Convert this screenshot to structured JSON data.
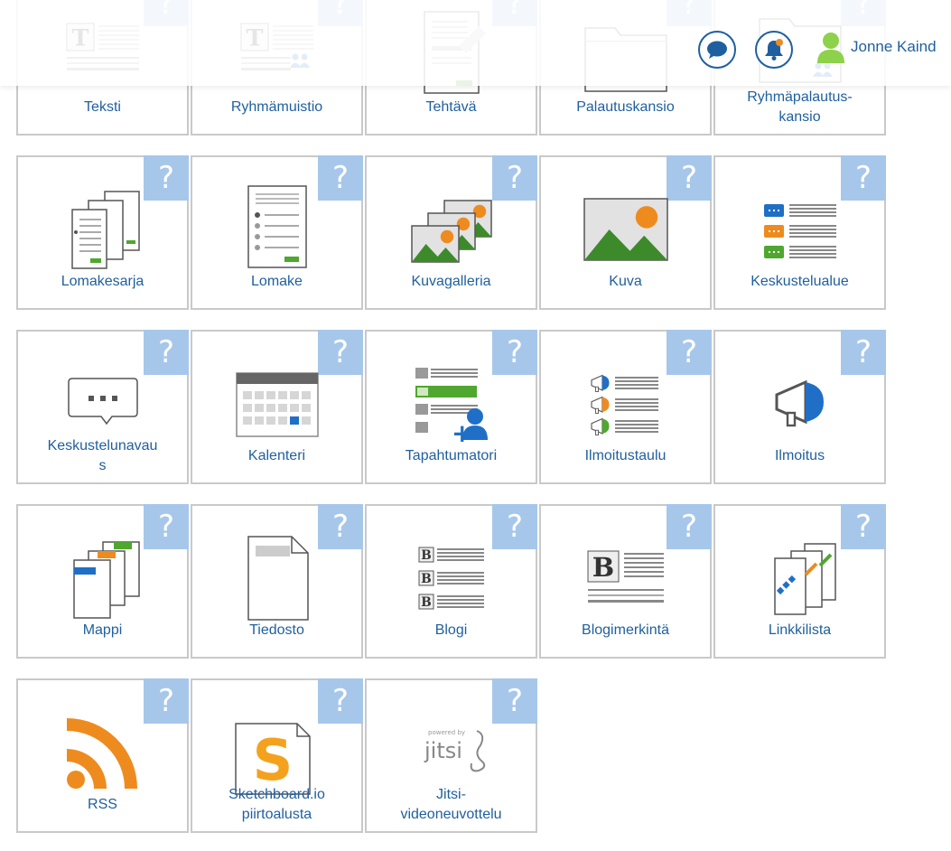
{
  "header": {
    "user_name": "Jonne Kaind",
    "chat_icon": "chat-bubble-icon",
    "notification_icon": "bell-icon",
    "avatar_icon": "user-avatar-icon"
  },
  "help_mark": "?",
  "colors": {
    "accent": "#1f5f9f",
    "help": "#a6c7ea",
    "border": "#c9c9c9",
    "green": "#4fa72f",
    "orange": "#ee8b1f"
  },
  "tiles": [
    {
      "label": "Teksti",
      "icon": "text-icon"
    },
    {
      "label": "Ryhmämuistio",
      "icon": "group-note-icon"
    },
    {
      "label": "Tehtävä",
      "icon": "assignment-icon"
    },
    {
      "label": "Palautuskansio",
      "icon": "return-folder-icon"
    },
    {
      "label": "Ryhmäpalautus-\nkansio",
      "icon": "group-return-folder-icon"
    },
    {
      "label": "Lomakesarja",
      "icon": "form-series-icon"
    },
    {
      "label": "Lomake",
      "icon": "form-icon"
    },
    {
      "label": "Kuvagalleria",
      "icon": "image-gallery-icon"
    },
    {
      "label": "Kuva",
      "icon": "image-icon"
    },
    {
      "label": "Keskustelualue",
      "icon": "discussion-area-icon"
    },
    {
      "label": "Keskustelunavau\ns",
      "icon": "discussion-thread-icon"
    },
    {
      "label": "Kalenteri",
      "icon": "calendar-icon"
    },
    {
      "label": "Tapahtumatori",
      "icon": "event-market-icon"
    },
    {
      "label": "Ilmoitustaulu",
      "icon": "notice-board-icon"
    },
    {
      "label": "Ilmoitus",
      "icon": "announcement-icon"
    },
    {
      "label": "Mappi",
      "icon": "binder-icon"
    },
    {
      "label": "Tiedosto",
      "icon": "file-icon"
    },
    {
      "label": "Blogi",
      "icon": "blog-icon"
    },
    {
      "label": "Blogimerkintä",
      "icon": "blog-entry-icon"
    },
    {
      "label": "Linkkilista",
      "icon": "link-list-icon"
    },
    {
      "label": "RSS",
      "icon": "rss-icon"
    },
    {
      "label": "Sketchboard.io\npiirtoalusta",
      "icon": "sketchboard-icon"
    },
    {
      "label": "Jitsi-\nvideoneuvottelu",
      "icon": "jitsi-icon"
    }
  ],
  "jitsi_logo": {
    "powered_by": "powered by",
    "name": "jitsi"
  }
}
